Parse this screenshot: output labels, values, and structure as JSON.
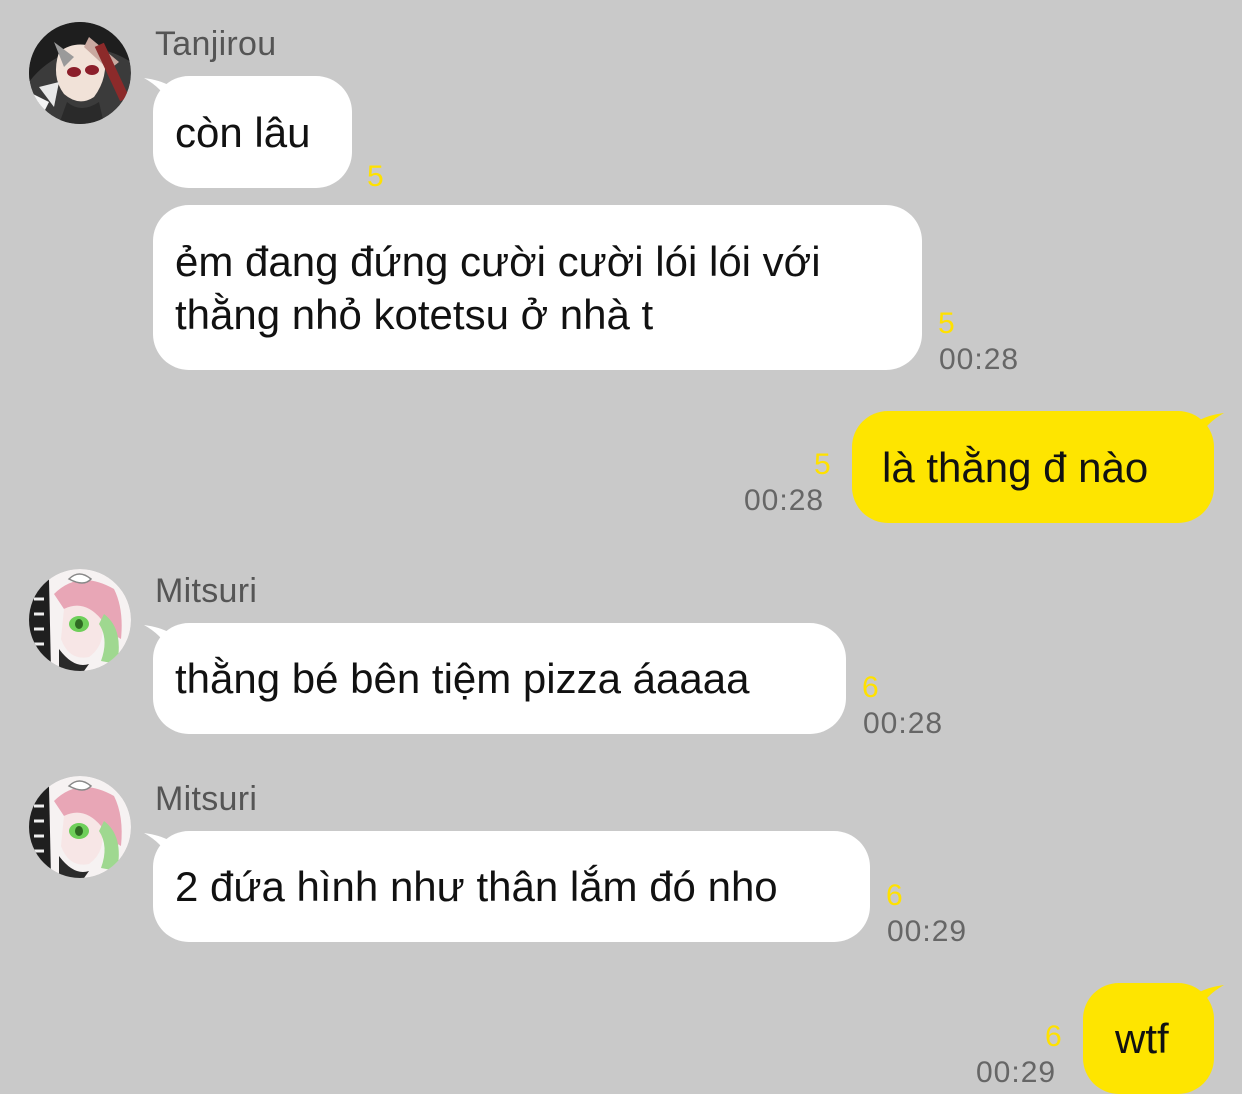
{
  "colors": {
    "background": "#c9c9c9",
    "incoming_bubble": "#ffffff",
    "outgoing_bubble": "#fee500",
    "unread_count": "#ffe100",
    "timestamp": "#666666",
    "sender_name": "#555555"
  },
  "messages": [
    {
      "sender": "Tanjirou",
      "text": "còn lâu",
      "unread": "5",
      "time": ""
    },
    {
      "sender": "",
      "text": "ẻm đang đứng cười cười lói lói với\nthằng nhỏ kotetsu ở nhà t",
      "unread": "5",
      "time": "00:28"
    },
    {
      "sender": "me",
      "text": "là thằng đ nào",
      "unread": "5",
      "time": "00:28"
    },
    {
      "sender": "Mitsuri",
      "text": "thằng bé bên tiệm pizza áaaaa",
      "unread": "6",
      "time": "00:28"
    },
    {
      "sender": "Mitsuri",
      "text": "2 đứa hình như thân lắm đó nho",
      "unread": "6",
      "time": "00:29"
    },
    {
      "sender": "me",
      "text": "wtf",
      "unread": "6",
      "time": "00:29"
    }
  ],
  "avatars": {
    "tanjirou": "tanjirou-avatar",
    "mitsuri": "mitsuri-avatar"
  }
}
